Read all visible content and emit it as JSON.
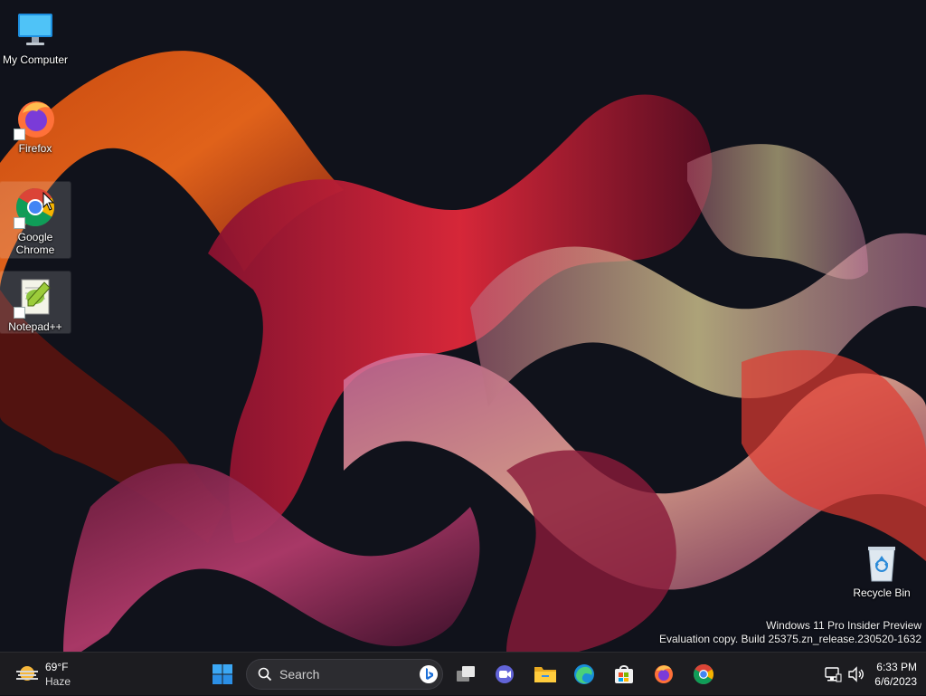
{
  "desktop": {
    "icons": [
      {
        "label": "My Computer"
      },
      {
        "label": "Firefox"
      },
      {
        "label": "Google Chrome"
      },
      {
        "label": "Notepad++"
      },
      {
        "label": "Recycle Bin"
      }
    ],
    "watermark": {
      "line1": "Windows 11 Pro Insider Preview",
      "line2": "Evaluation copy. Build 25375.zn_release.230520-1632"
    }
  },
  "taskbar": {
    "weather": {
      "temp": "69°F",
      "condition": "Haze"
    },
    "search": {
      "placeholder": "Search"
    },
    "pinned": [
      {
        "icon": "windows-start-icon"
      },
      {
        "icon": "task-view-icon"
      },
      {
        "icon": "teams-chat-icon"
      },
      {
        "icon": "file-explorer-icon"
      },
      {
        "icon": "edge-icon"
      },
      {
        "icon": "microsoft-store-icon"
      },
      {
        "icon": "firefox-icon"
      },
      {
        "icon": "chrome-icon"
      }
    ],
    "clock": {
      "time": "6:33 PM",
      "date": "6/6/2023"
    }
  }
}
